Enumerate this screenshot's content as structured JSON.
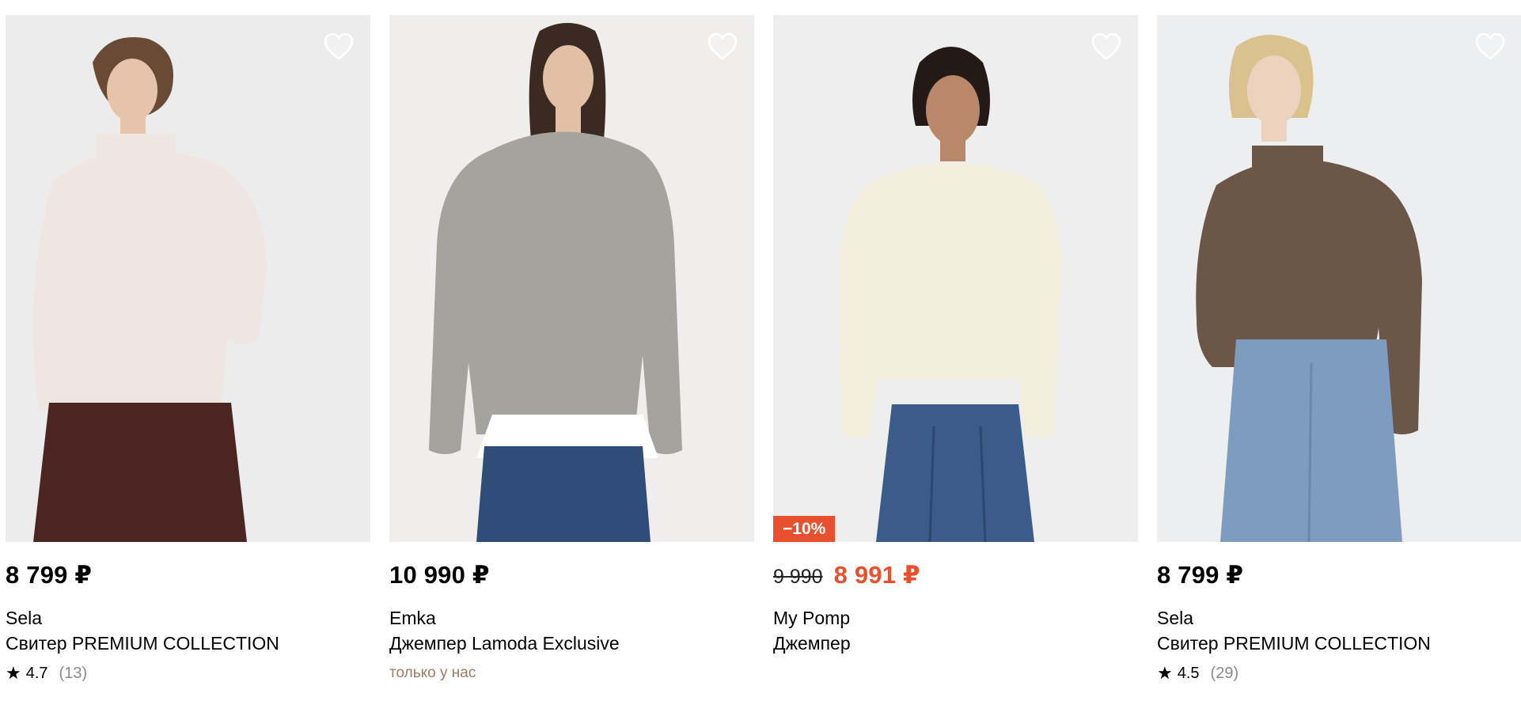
{
  "currency": "₽",
  "products": [
    {
      "price": "8 799 ₽",
      "brand": "Sela",
      "title": "Свитер PREMIUM COLLECTION",
      "rating": "4.7",
      "reviews": "(13)",
      "sweater_color": "#efe5e1",
      "bottom_color": "#4a2521"
    },
    {
      "price": "10 990 ₽",
      "brand": "Emka",
      "title": "Джемпер Lamoda Exclusive",
      "exclusive_label": "только у нас",
      "sweater_color": "#a5a39d",
      "bottom_color": "#2f4d78"
    },
    {
      "old_price": "9 990",
      "price": "8 991 ₽",
      "discount": "−10%",
      "brand": "My Pomp",
      "title": "Джемпер",
      "sweater_color": "#f3eddd",
      "bottom_color": "#3b5b8a"
    },
    {
      "price": "8 799 ₽",
      "brand": "Sela",
      "title": "Свитер PREMIUM COLLECTION",
      "rating": "4.5",
      "reviews": "(29)",
      "sweater_color": "#6b5647",
      "bottom_color": "#7e9cc0"
    }
  ],
  "colors": {
    "sale": "#e8502e",
    "exclusive": "#9b7c60",
    "muted": "#8a8a8a",
    "photo_bg": "#eeeeef"
  },
  "icons": {
    "favorite": "heart-outline-icon",
    "rating": "star-icon"
  }
}
